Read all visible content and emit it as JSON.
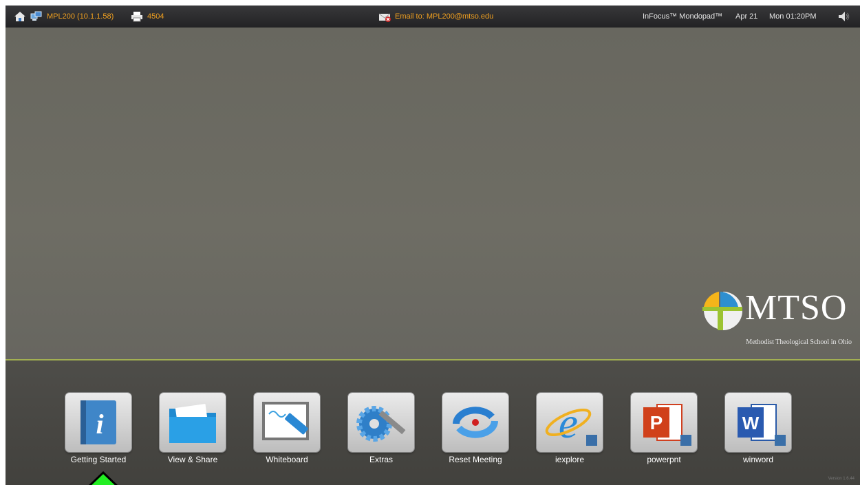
{
  "topbar": {
    "device_label": "MPL200 (10.1.1.58)",
    "code": "4504",
    "email": "Email to: MPL200@mtso.edu",
    "brand": "InFocus™ Mondopad™",
    "date": "Apr 21",
    "time": "Mon 01:20PM"
  },
  "logo": {
    "name": "MTSO",
    "subtitle": "Methodist Theological School in Ohio"
  },
  "dock": {
    "items": [
      {
        "label": "Getting Started",
        "icon": "info-book-icon"
      },
      {
        "label": "View & Share",
        "icon": "folder-icon"
      },
      {
        "label": "Whiteboard",
        "icon": "whiteboard-icon"
      },
      {
        "label": "Extras",
        "icon": "gear-wrench-icon"
      },
      {
        "label": "Reset Meeting",
        "icon": "reset-icon"
      },
      {
        "label": "iexplore",
        "icon": "internet-explorer-icon"
      },
      {
        "label": "powerpnt",
        "icon": "powerpoint-icon"
      },
      {
        "label": "winword",
        "icon": "word-icon"
      }
    ]
  },
  "version": "Version 1.6.44",
  "colors": {
    "accent": "#f0a020",
    "divider": "#a3b052",
    "cursor": "#22ee22"
  }
}
